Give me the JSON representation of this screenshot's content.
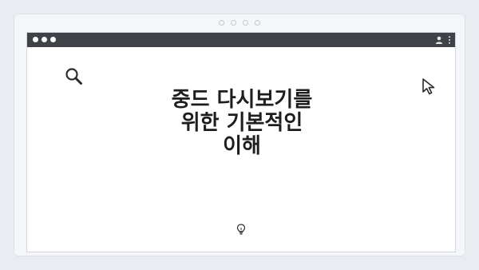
{
  "headline": {
    "line1": "중드 다시보기를",
    "line2": "위한 기본적인",
    "line3": "이해"
  },
  "icons": {
    "search": "search-icon",
    "cursor": "cursor-icon",
    "user": "user-icon",
    "menu": "kebab-menu-icon",
    "hint": "lightbulb-icon"
  },
  "colors": {
    "page_background": "#e9edf2",
    "titlebar": "#3f4246",
    "content_background": "#ffffff",
    "text": "#1e1e1e"
  }
}
